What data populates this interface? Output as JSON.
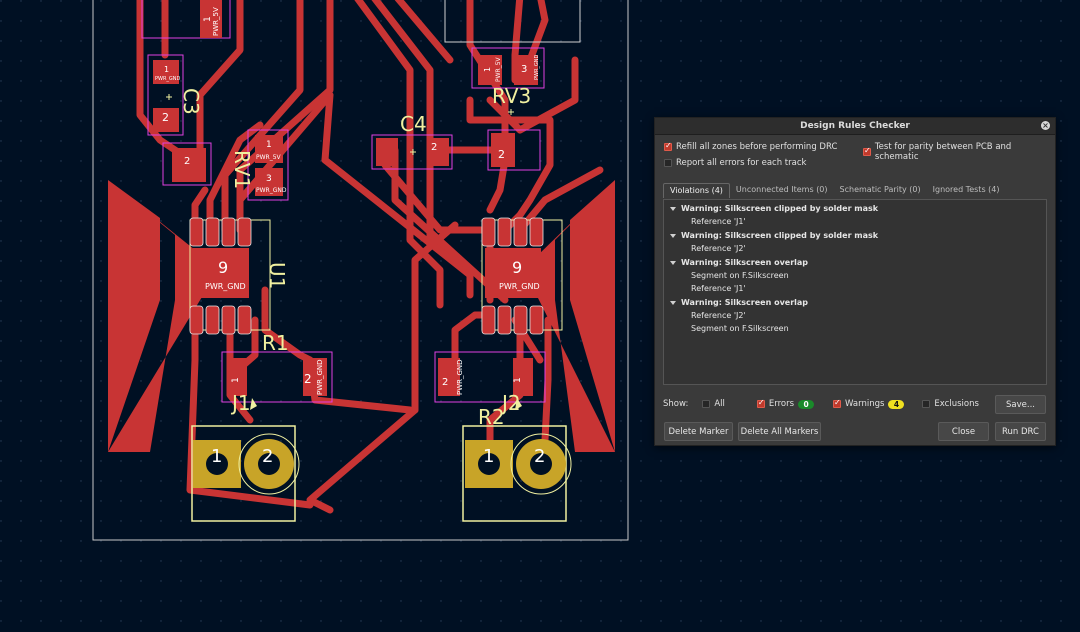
{
  "pcb": {
    "labels": {
      "c3": "C3",
      "c4": "C4",
      "rv1": "RV1",
      "rv3": "RV3",
      "u1": "U1",
      "r1": "R1",
      "r2": "R2",
      "j1": "J1",
      "j2": "J2",
      "pad9_left": "9",
      "pad9_right": "9",
      "pwr_gnd": "PWR_GND",
      "pwr_5v": "PWR_5V",
      "num1": "1",
      "num2": "2",
      "num3": "3"
    },
    "colors": {
      "background": "#001023",
      "copper": "#c83434",
      "pad": "#c8a428",
      "silk": "#f0f0a0",
      "courtyard": "#e040e0",
      "edge": "#d0d0d0"
    }
  },
  "dialog": {
    "title": "Design Rules Checker",
    "close_icon": "close-icon",
    "options": {
      "refill_zones": "Refill all zones before performing DRC",
      "report_all": "Report all errors for each track",
      "test_parity": "Test for parity between PCB and schematic"
    },
    "tabs": [
      "Violations (4)",
      "Unconnected Items (0)",
      "Schematic Parity (0)",
      "Ignored Tests (4)"
    ],
    "violations": [
      {
        "title": "Warning: Silkscreen clipped by solder mask",
        "items": [
          "Reference 'J1'"
        ]
      },
      {
        "title": "Warning: Silkscreen clipped by solder mask",
        "items": [
          "Reference 'J2'"
        ]
      },
      {
        "title": "Warning: Silkscreen overlap",
        "items": [
          "Segment on F.Silkscreen",
          "Reference 'J1'"
        ]
      },
      {
        "title": "Warning: Silkscreen overlap",
        "items": [
          "Reference 'J2'",
          "Segment on F.Silkscreen"
        ]
      }
    ],
    "show": {
      "label": "Show:",
      "all": "All",
      "errors": "Errors",
      "errors_count": "0",
      "warnings": "Warnings",
      "warnings_count": "4",
      "exclusions": "Exclusions"
    },
    "buttons": {
      "save": "Save...",
      "delete_marker": "Delete Marker",
      "delete_all": "Delete All Markers",
      "close": "Close",
      "run": "Run DRC"
    }
  }
}
